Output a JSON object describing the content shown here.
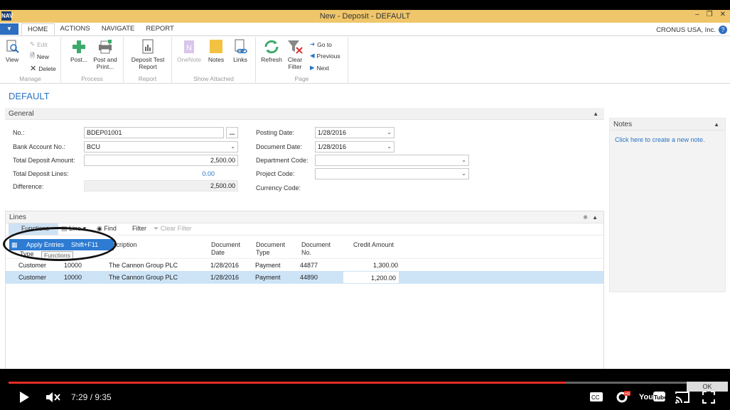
{
  "window": {
    "title": "New - Deposit - DEFAULT",
    "logo": "NAV"
  },
  "tabs": [
    "HOME",
    "ACTIONS",
    "NAVIGATE",
    "REPORT"
  ],
  "company": "CRONUS USA, Inc.",
  "ribbon": {
    "manage": {
      "label": "Manage",
      "view": "View",
      "edit": "Edit",
      "new": "New",
      "delete": "Delete"
    },
    "process": {
      "label": "Process",
      "post": "Post...",
      "post_print": "Post and Print..."
    },
    "report": {
      "label": "Report",
      "deposit_test": "Deposit Test Report"
    },
    "attached": {
      "label": "Show Attached",
      "onenote": "OneNote",
      "notes": "Notes",
      "links": "Links"
    },
    "page": {
      "label": "Page",
      "refresh": "Refresh",
      "clear_filter": "Clear Filter",
      "goto": "Go to",
      "previous": "Previous",
      "next": "Next"
    }
  },
  "page_title": "DEFAULT",
  "general": {
    "header": "General",
    "no_label": "No.:",
    "no_value": "BDEP01001",
    "bank_label": "Bank Account No.:",
    "bank_value": "BCU",
    "total_amount_label": "Total Deposit Amount:",
    "total_amount_value": "2,500.00",
    "total_lines_label": "Total Deposit Lines:",
    "total_lines_value": "0.00",
    "difference_label": "Difference:",
    "difference_value": "2,500.00",
    "posting_date_label": "Posting Date:",
    "posting_date_value": "1/28/2016",
    "document_date_label": "Document Date:",
    "document_date_value": "1/28/2016",
    "department_label": "Department Code:",
    "department_value": "",
    "project_label": "Project Code:",
    "project_value": "",
    "currency_label": "Currency Code:"
  },
  "notes": {
    "header": "Notes",
    "link": "Click here to create a new note."
  },
  "lines": {
    "header": "Lines",
    "toolbar": {
      "functions": "Functions",
      "line": "Line",
      "find": "Find",
      "filter": "Filter",
      "clear_filter": "Clear Filter"
    },
    "columns": [
      "Type",
      "escription",
      "Document Date",
      "Document Type",
      "Document No.",
      "Credit Amount"
    ],
    "rows": [
      {
        "type": "Customer",
        "no": "10000",
        "desc": "The Cannon Group PLC",
        "date": "1/28/2016",
        "doctype": "Payment",
        "docno": "44877",
        "amount": "1,300.00"
      },
      {
        "type": "Customer",
        "no": "10000",
        "desc": "The Cannon Group PLC",
        "date": "1/28/2016",
        "doctype": "Payment",
        "docno": "44890",
        "amount": "1,200.00"
      }
    ],
    "menu": {
      "item": "Apply Entries",
      "shortcut": "Shift+F11",
      "tooltip": "Functions"
    }
  },
  "video": {
    "time": "7:29 / 9:35",
    "progress": 0.782,
    "ok": "OK"
  },
  "colors": {
    "accent": "#2d7bd2",
    "titlebar": "#f0c66a",
    "progress": "#e52d27"
  }
}
